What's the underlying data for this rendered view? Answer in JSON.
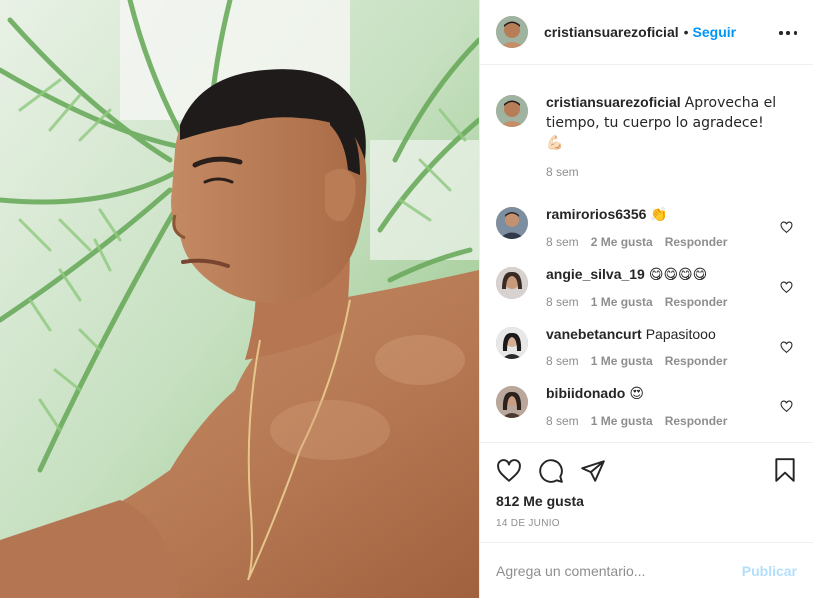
{
  "post": {
    "photo_alt": "",
    "header": {
      "username": "cristiansuarezoficial",
      "separator": "•",
      "follow_label": "Seguir",
      "more_icon": "more-options-icon"
    },
    "caption": {
      "username": "cristiansuarezoficial",
      "text": "Aprovecha el tiempo, tu cuerpo lo agradece! 💪🏻",
      "time": "8 sem"
    },
    "comments": [
      {
        "username": "ramirorios6356",
        "text": "👏",
        "time": "8 sem",
        "likes": "2 Me gusta",
        "reply": "Responder"
      },
      {
        "username": "angie_silva_19",
        "text": "😋😋😋😋",
        "time": "8 sem",
        "likes": "1 Me gusta",
        "reply": "Responder"
      },
      {
        "username": "vanebetancurt",
        "text": "Papasitooo",
        "time": "8 sem",
        "likes": "1 Me gusta",
        "reply": "Responder"
      },
      {
        "username": "bibiidonado",
        "text": "😍",
        "time": "8 sem",
        "likes": "1 Me gusta",
        "reply": "Responder"
      }
    ],
    "actions": {
      "like_icon": "heart-icon",
      "comment_icon": "comment-bubble-icon",
      "share_icon": "paper-plane-icon",
      "save_icon": "bookmark-icon"
    },
    "likes_count": "812 Me gusta",
    "date": "14 DE JUNIO",
    "add_comment": {
      "placeholder": "Agrega un comentario...",
      "publish_label": "Publicar"
    }
  },
  "colors": {
    "link_blue": "#0095f6",
    "publish_disabled": "#b2dffc",
    "muted_text": "#8e8e8e",
    "border": "#efefef"
  }
}
